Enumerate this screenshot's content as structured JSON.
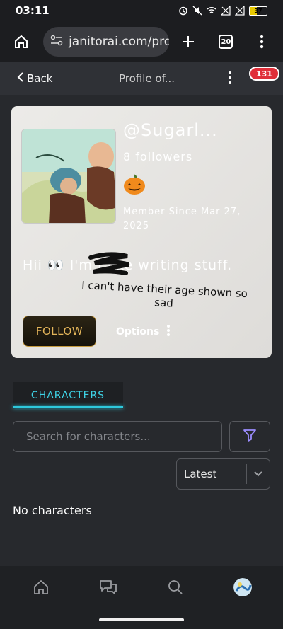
{
  "status_bar": {
    "time": "03:11",
    "battery": "37"
  },
  "browser": {
    "url": "janitorai.com/prof",
    "tab_count": "20"
  },
  "header": {
    "back_label": "Back",
    "title": "Profile of...",
    "notification_count": "131"
  },
  "profile": {
    "username": "@Sugarl...",
    "followers": "8 followers",
    "emoji": "🎃",
    "member_since": "Member Since Mar 27, 2025",
    "bio": "Hii 👀 I'm        I like writing stuff.",
    "annotation": "I can't have their age shown so sad",
    "follow_label": "FOLLOW",
    "options_label": "Options"
  },
  "tabs": {
    "characters_label": "CHARACTERS"
  },
  "search": {
    "placeholder": "Search for characters..."
  },
  "sort": {
    "selected": "Latest"
  },
  "empty_state": "No characters",
  "colors": {
    "accent": "#2ec8dc",
    "follow_gold": "#c59a3d",
    "filter_purple": "#9b8cff",
    "badge_red": "#e02f3a"
  }
}
